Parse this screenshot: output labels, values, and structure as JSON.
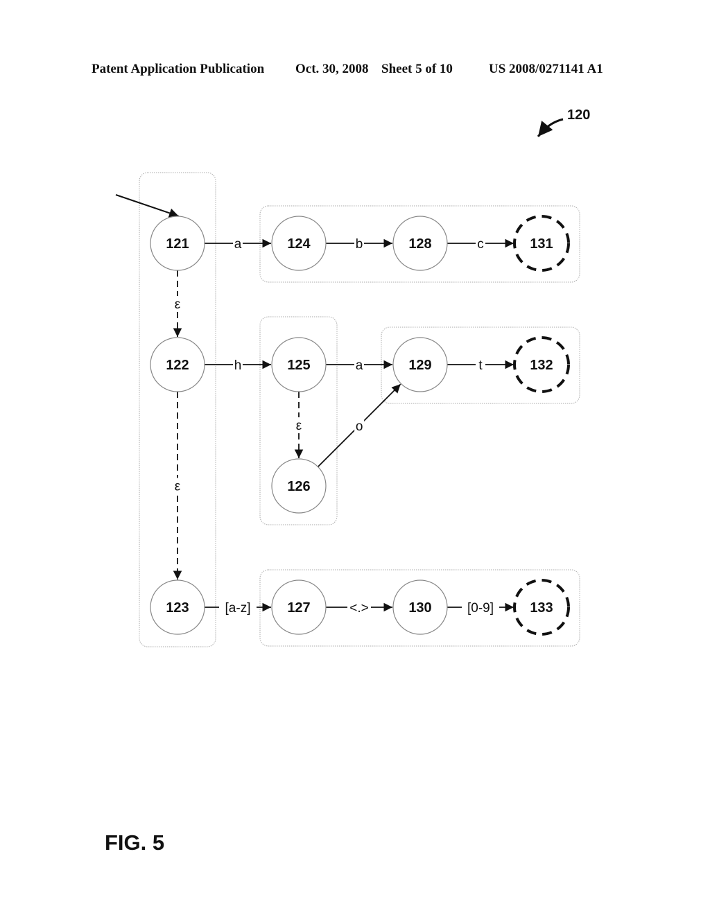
{
  "header": {
    "publication": "Patent Application Publication",
    "date": "Oct. 30, 2008",
    "sheet": "Sheet 5 of 10",
    "number": "US 2008/0271141 A1"
  },
  "reference_numeral": "120",
  "figure_label": "FIG. 5",
  "diagram": {
    "type": "state-machine (NFA)",
    "start_state": "121",
    "states": [
      {
        "id": "121",
        "accepting": false
      },
      {
        "id": "122",
        "accepting": false
      },
      {
        "id": "123",
        "accepting": false
      },
      {
        "id": "124",
        "accepting": false
      },
      {
        "id": "125",
        "accepting": false
      },
      {
        "id": "126",
        "accepting": false
      },
      {
        "id": "127",
        "accepting": false
      },
      {
        "id": "128",
        "accepting": false
      },
      {
        "id": "129",
        "accepting": false
      },
      {
        "id": "130",
        "accepting": false
      },
      {
        "id": "131",
        "accepting": true
      },
      {
        "id": "132",
        "accepting": true
      },
      {
        "id": "133",
        "accepting": true
      }
    ],
    "transitions": [
      {
        "from": "121",
        "to": "124",
        "label": "a",
        "style": "solid"
      },
      {
        "from": "124",
        "to": "128",
        "label": "b",
        "style": "solid"
      },
      {
        "from": "128",
        "to": "131",
        "label": "c",
        "style": "solid"
      },
      {
        "from": "121",
        "to": "122",
        "label": "ε",
        "style": "dashed"
      },
      {
        "from": "122",
        "to": "125",
        "label": "h",
        "style": "solid"
      },
      {
        "from": "125",
        "to": "129",
        "label": "a",
        "style": "solid"
      },
      {
        "from": "129",
        "to": "132",
        "label": "t",
        "style": "solid"
      },
      {
        "from": "125",
        "to": "126",
        "label": "ε",
        "style": "dashed"
      },
      {
        "from": "126",
        "to": "129",
        "label": "o",
        "style": "solid"
      },
      {
        "from": "122",
        "to": "123",
        "label": "ε",
        "style": "dashed"
      },
      {
        "from": "123",
        "to": "127",
        "label": "[a-z]",
        "style": "solid"
      },
      {
        "from": "127",
        "to": "130",
        "label": "<.>",
        "style": "solid"
      },
      {
        "from": "130",
        "to": "133",
        "label": "[0-9]",
        "style": "solid"
      }
    ],
    "groups": [
      {
        "name": "group-121-122-123",
        "members": [
          "121",
          "122",
          "123"
        ]
      },
      {
        "name": "group-124-128-131",
        "members": [
          "124",
          "128",
          "131"
        ]
      },
      {
        "name": "group-125-126",
        "members": [
          "125",
          "126"
        ]
      },
      {
        "name": "group-129-132",
        "members": [
          "129",
          "132"
        ]
      },
      {
        "name": "group-127-130-133",
        "members": [
          "127",
          "130",
          "133"
        ]
      }
    ]
  }
}
